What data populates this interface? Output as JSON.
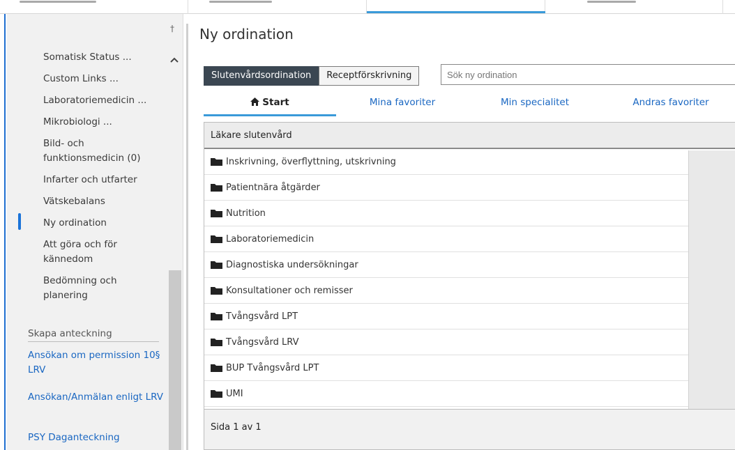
{
  "sidebar": {
    "items": [
      {
        "label": "Somatisk Status ..."
      },
      {
        "label": "Custom Links ..."
      },
      {
        "label": "Laboratoriemedicin ..."
      },
      {
        "label": "Mikrobiologi ..."
      },
      {
        "label": "Bild- och funktionsmedicin (0)"
      },
      {
        "label": "Infarter och utfarter"
      },
      {
        "label": "Vätskebalans"
      },
      {
        "label": "Ny ordination"
      },
      {
        "label": "Att göra och för kännedom"
      },
      {
        "label": "Bedömning och planering"
      }
    ],
    "section_label": "Skapa anteckning",
    "note_links": [
      {
        "label": "Ansökan om permission 10§ LRV"
      },
      {
        "label": "Ansökan/Anmälan enligt LRV"
      },
      {
        "label": "PSY Daganteckning"
      }
    ]
  },
  "main": {
    "title": "Ny ordination",
    "buttons": {
      "inpatient": "Slutenvårdsordination",
      "prescription": "Receptförskrivning"
    },
    "search": {
      "placeholder": "Sök ny ordination"
    },
    "tabs": {
      "start": "Start",
      "my_favorites": "Mina favoriter",
      "my_specialty": "Min specialitet",
      "others_favorites": "Andras favoriter"
    },
    "panel_header": "Läkare slutenvård",
    "folders": [
      "Inskrivning, överflyttning, utskrivning",
      "Patientnära åtgärder",
      "Nutrition",
      "Laboratoriemedicin",
      "Diagnostiska undersökningar",
      "Konsultationer och remisser",
      "Tvångsvård LPT",
      "Tvångsvård LRV",
      "BUP Tvångsvård LPT",
      "UMI"
    ],
    "pager": "Sida 1 av 1"
  }
}
